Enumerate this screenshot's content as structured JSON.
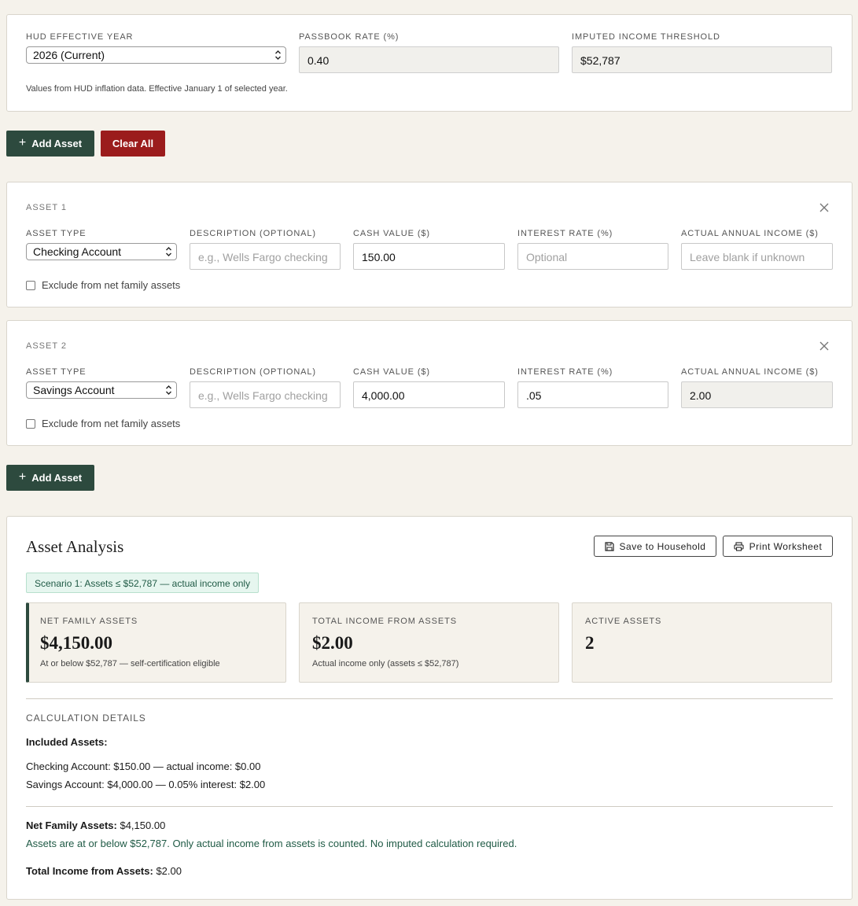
{
  "settings": {
    "hud_year_label": "HUD EFFECTIVE YEAR",
    "hud_year_value": "2026 (Current)",
    "passbook_label": "PASSBOOK RATE (%)",
    "passbook_value": "0.40",
    "threshold_label": "IMPUTED INCOME THRESHOLD",
    "threshold_value": "$52,787",
    "note": "Values from HUD inflation data. Effective January 1 of selected year."
  },
  "toolbar": {
    "add_asset_label": "Add Asset",
    "clear_all_label": "Clear All"
  },
  "field_labels": {
    "asset_type": "ASSET TYPE",
    "description": "DESCRIPTION (OPTIONAL)",
    "cash_value": "CASH VALUE ($)",
    "interest_rate": "INTEREST RATE (%)",
    "actual_income": "ACTUAL ANNUAL INCOME ($)",
    "exclude": "Exclude from net family assets"
  },
  "assets": [
    {
      "title": "ASSET 1",
      "type": "Checking Account",
      "description_placeholder": "e.g., Wells Fargo checking",
      "cash_value": "150.00",
      "interest_placeholder": "Optional",
      "income_placeholder": "Leave blank if unknown"
    },
    {
      "title": "ASSET 2",
      "type": "Savings Account",
      "description_placeholder": "e.g., Wells Fargo checking",
      "cash_value": "4,000.00",
      "interest_rate": ".05",
      "actual_income": "2.00"
    }
  ],
  "bottom_add_label": "Add Asset",
  "analysis": {
    "title": "Asset Analysis",
    "save_label": "Save to Household",
    "print_label": "Print Worksheet",
    "scenario_badge": "Scenario 1: Assets ≤ $52,787 — actual income only",
    "stats": [
      {
        "label": "NET FAMILY ASSETS",
        "value": "$4,150.00",
        "sub": "At or below $52,787 — self-certification eligible"
      },
      {
        "label": "TOTAL INCOME FROM ASSETS",
        "value": "$2.00",
        "sub": "Actual income only (assets ≤ $52,787)"
      },
      {
        "label": "ACTIVE ASSETS",
        "value": "2"
      }
    ],
    "details_heading": "CALCULATION DETAILS",
    "included_heading": "Included Assets:",
    "included_lines": [
      "Checking Account: $150.00 — actual income: $0.00",
      "Savings Account: $4,000.00 — 0.05% interest: $2.00"
    ],
    "net_label": "Net Family Assets:",
    "net_value": "$4,150.00",
    "scenario_note": "Assets are at or below $52,787. Only actual income from assets is counted. No imputed calculation required.",
    "total_label": "Total Income from Assets:",
    "total_value": "$2.00"
  }
}
